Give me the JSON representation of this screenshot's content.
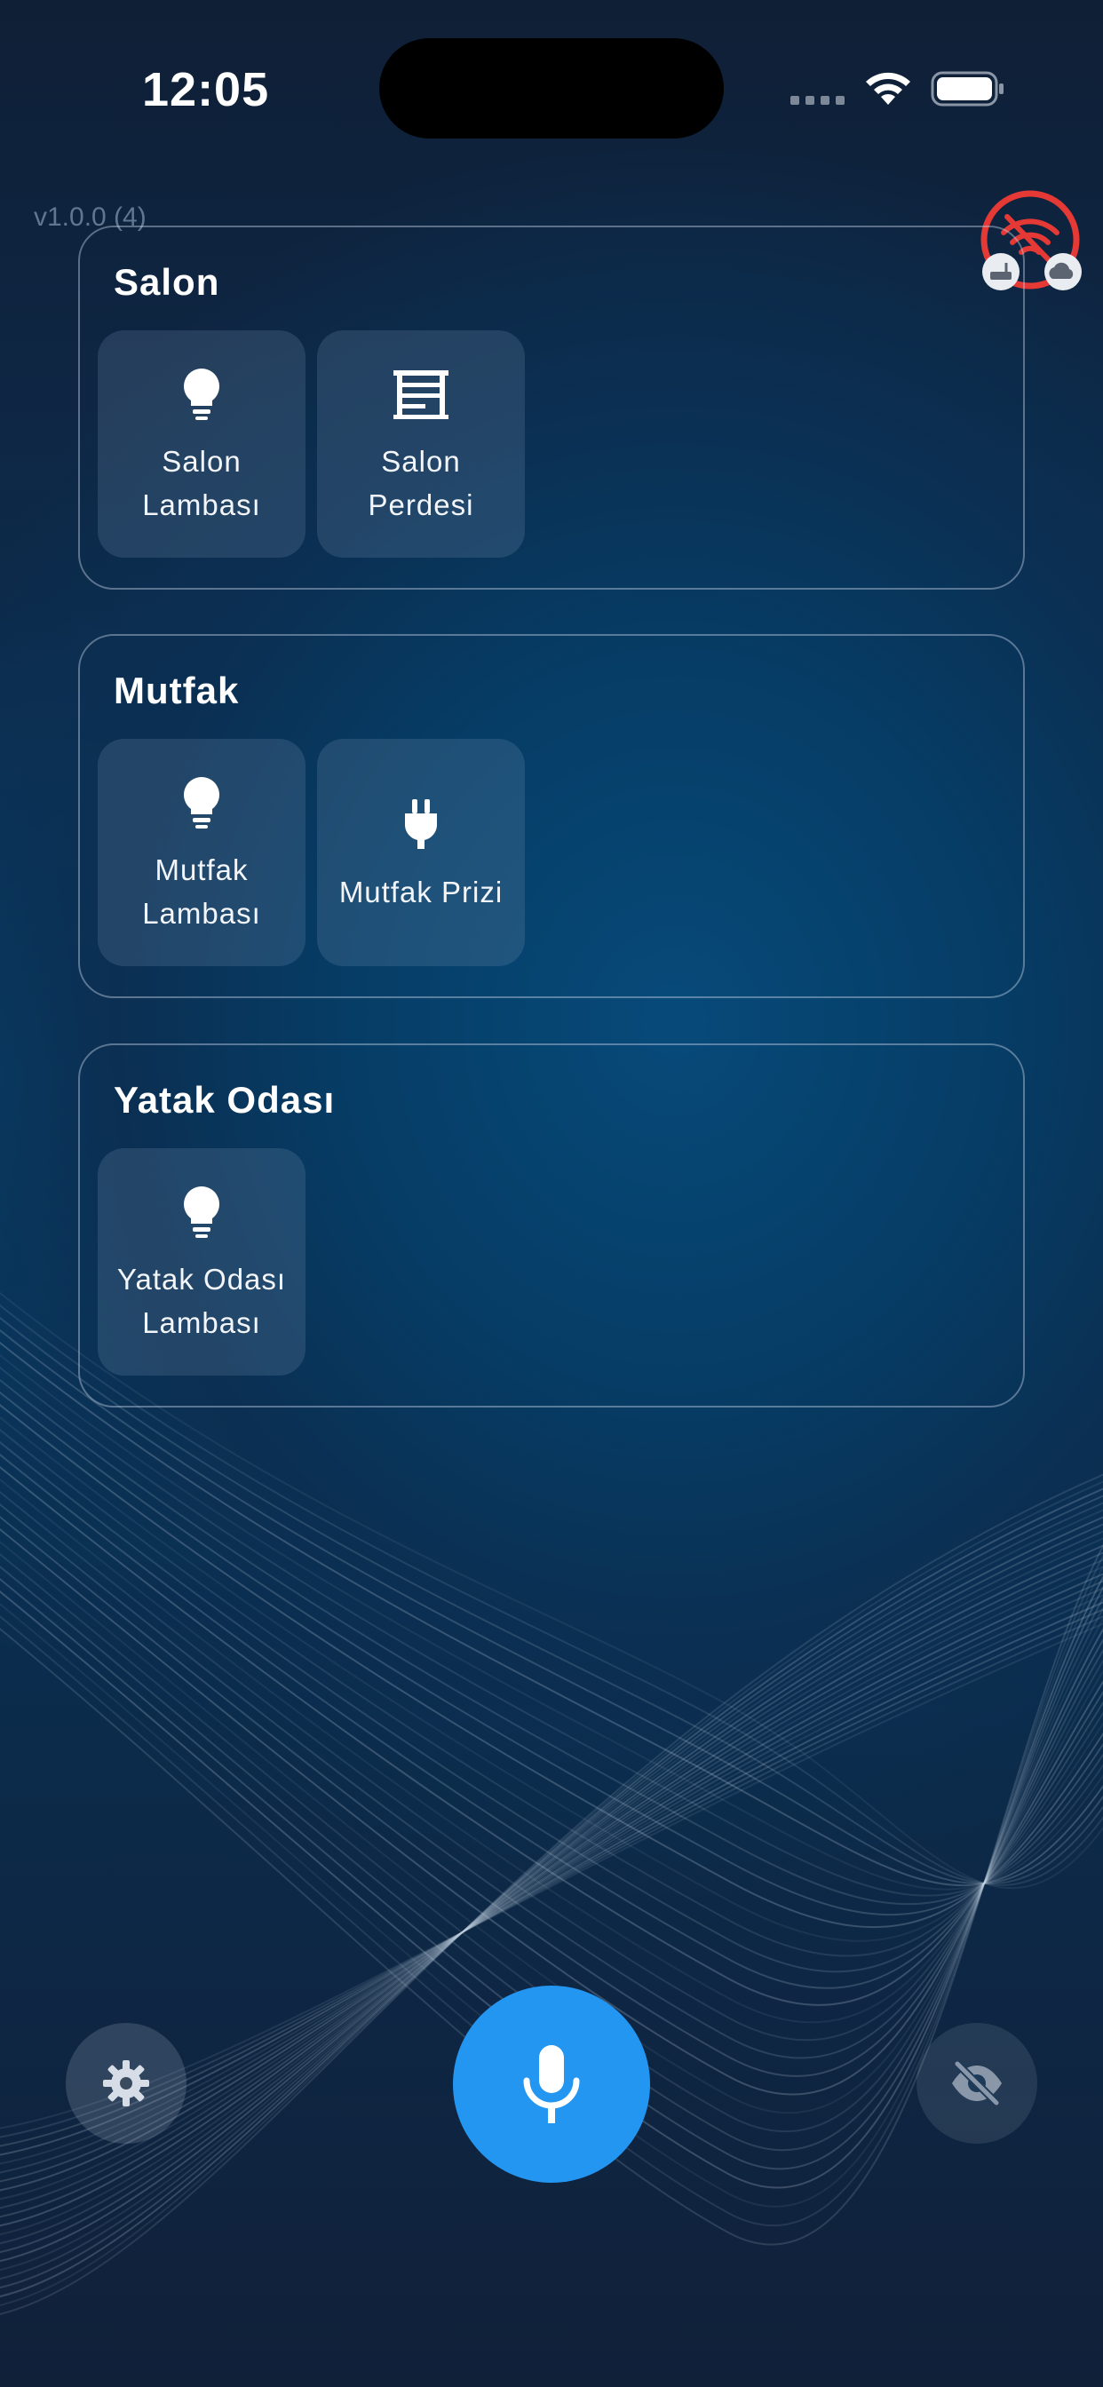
{
  "status_bar": {
    "time": "12:05",
    "icons": [
      "cellular-signal-icon",
      "wifi-icon",
      "battery-icon"
    ]
  },
  "app": {
    "version": "v1.0.0 (4)"
  },
  "connection_status": {
    "icon": "wifi-off-icon",
    "sub_icons": [
      "router-icon",
      "cloud-icon"
    ],
    "color": "#e53935"
  },
  "rooms": [
    {
      "name": "Salon",
      "devices": [
        {
          "label": "Salon Lambası",
          "icon": "lightbulb-icon"
        },
        {
          "label": "Salon Perdesi",
          "icon": "curtain-icon"
        }
      ]
    },
    {
      "name": "Mutfak",
      "devices": [
        {
          "label": "Mutfak Lambası",
          "icon": "lightbulb-icon"
        },
        {
          "label": "Mutfak Prizi",
          "icon": "power-plug-icon"
        }
      ]
    },
    {
      "name": "Yatak Odası",
      "devices": [
        {
          "label": "Yatak Odası Lambası",
          "icon": "lightbulb-icon"
        }
      ]
    }
  ],
  "bottom_bar": {
    "left": "gear-icon",
    "center": "microphone-icon",
    "right": "eye-off-icon",
    "accent_color": "#2396f2"
  }
}
